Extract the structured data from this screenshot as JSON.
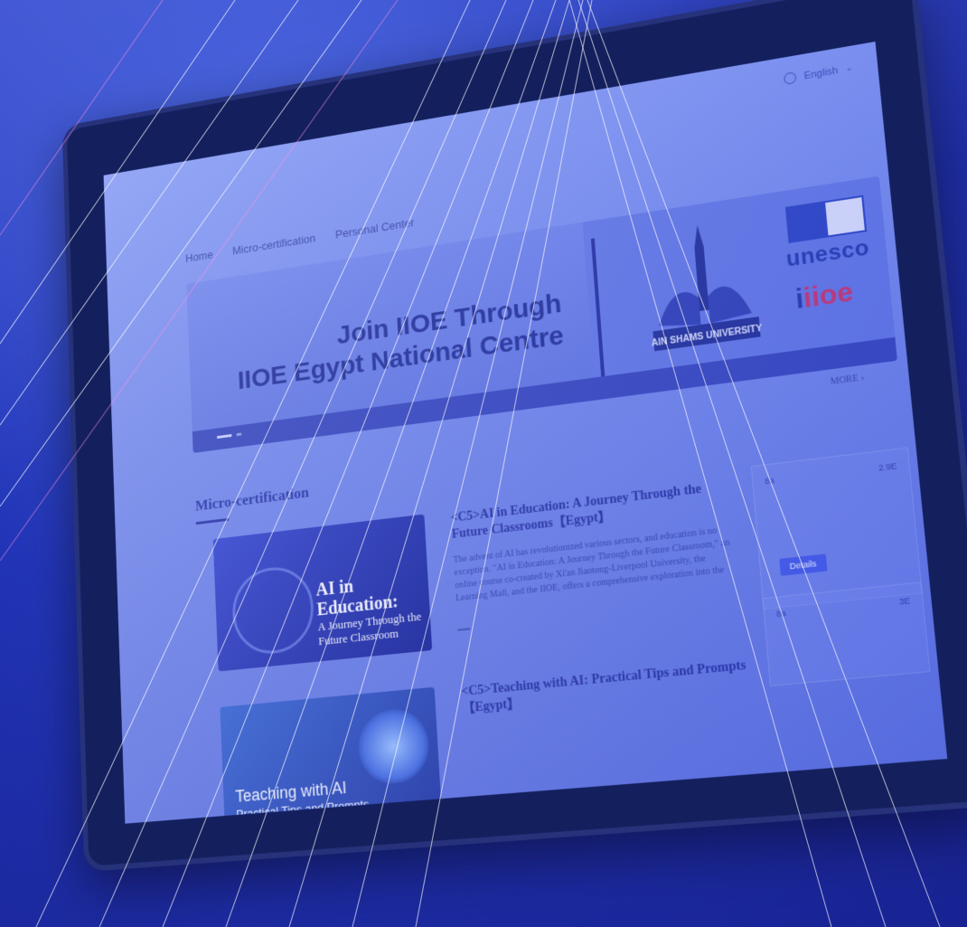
{
  "header": {
    "language": "English"
  },
  "nav": {
    "items": [
      "Home",
      "Micro-certification",
      "Personal Center"
    ]
  },
  "banner": {
    "title_line1": "Join IIOE Through",
    "title_line2": "IIOE Egypt National Centre",
    "seal_text": "AIN SHAMS UNIVERSITY",
    "unesco": "unesco",
    "iioe": "iioe"
  },
  "more_label": "MORE ›",
  "section": {
    "title": "Micro-certification"
  },
  "courses": [
    {
      "title": "<C5>AI in Education: A Journey Through the Future Classrooms【Egypt】",
      "description": "The advent of AI has revolutionized various sectors, and education is no exception. \"AI in Education: A Journey Through the Future Classroom,\" an online course co-created by Xi'an Jiaotong-Liverpool University, the Learning Mall, and the IIOE, offers a comprehensive exploration into the",
      "thumb_title": "AI in Education:",
      "thumb_sub": "A Journey Through the Future Classroom",
      "stat_left": "8a",
      "stat_right": "2.9E",
      "detail_label": "Details"
    },
    {
      "title": "<C5>Teaching with AI: Practical Tips and Prompts【Egypt】",
      "thumb_title": "Teaching with AI",
      "thumb_sub": "Practical Tips and Prompts",
      "stat_left": "8a",
      "stat_right": "3E"
    }
  ]
}
